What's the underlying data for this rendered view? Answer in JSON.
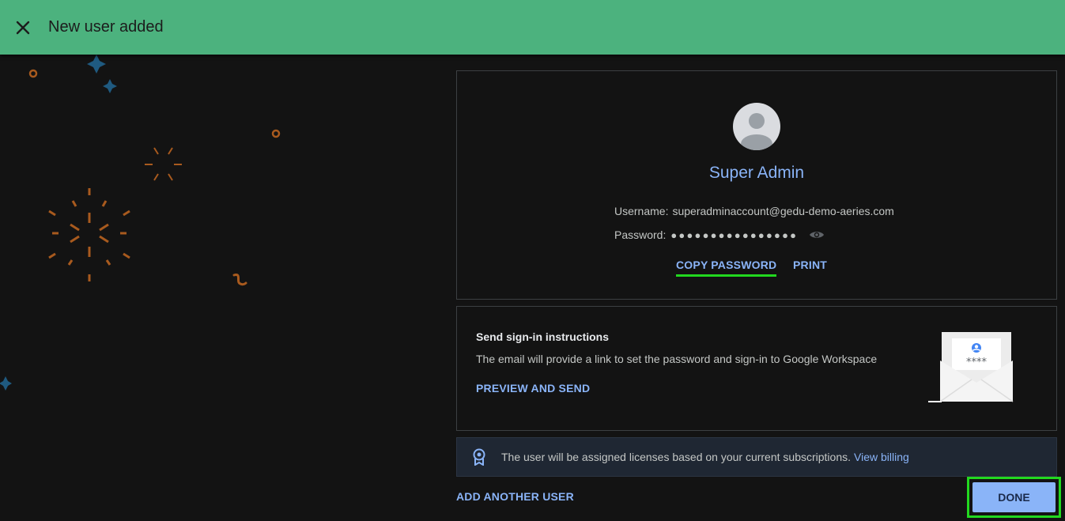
{
  "header": {
    "title": "New user added",
    "close_icon": "close-icon"
  },
  "user": {
    "name": "Super Admin",
    "username_label": "Username:",
    "username": "superadminaccount@gedu-demo-aeries.com",
    "password_label": "Password:",
    "password_masked": "●●●●●●●●●●●●●●●●",
    "copy_password": "COPY PASSWORD",
    "print": "PRINT"
  },
  "send": {
    "title": "Send sign-in instructions",
    "description": "The email will provide a link to set the password and sign-in to Google Workspace",
    "preview_and_send": "PREVIEW AND SEND",
    "envelope_text": "****"
  },
  "license": {
    "text": "The user will be assigned licenses based on your current subscriptions.",
    "link": "View billing"
  },
  "footer": {
    "add_another": "ADD ANOTHER USER",
    "done": "DONE"
  },
  "colors": {
    "header_bg": "#4cb27e",
    "accent": "#8ab4f8",
    "highlight": "#22d81f",
    "confetti_orange": "#a85a1e",
    "confetti_blue": "#1f5a80"
  }
}
